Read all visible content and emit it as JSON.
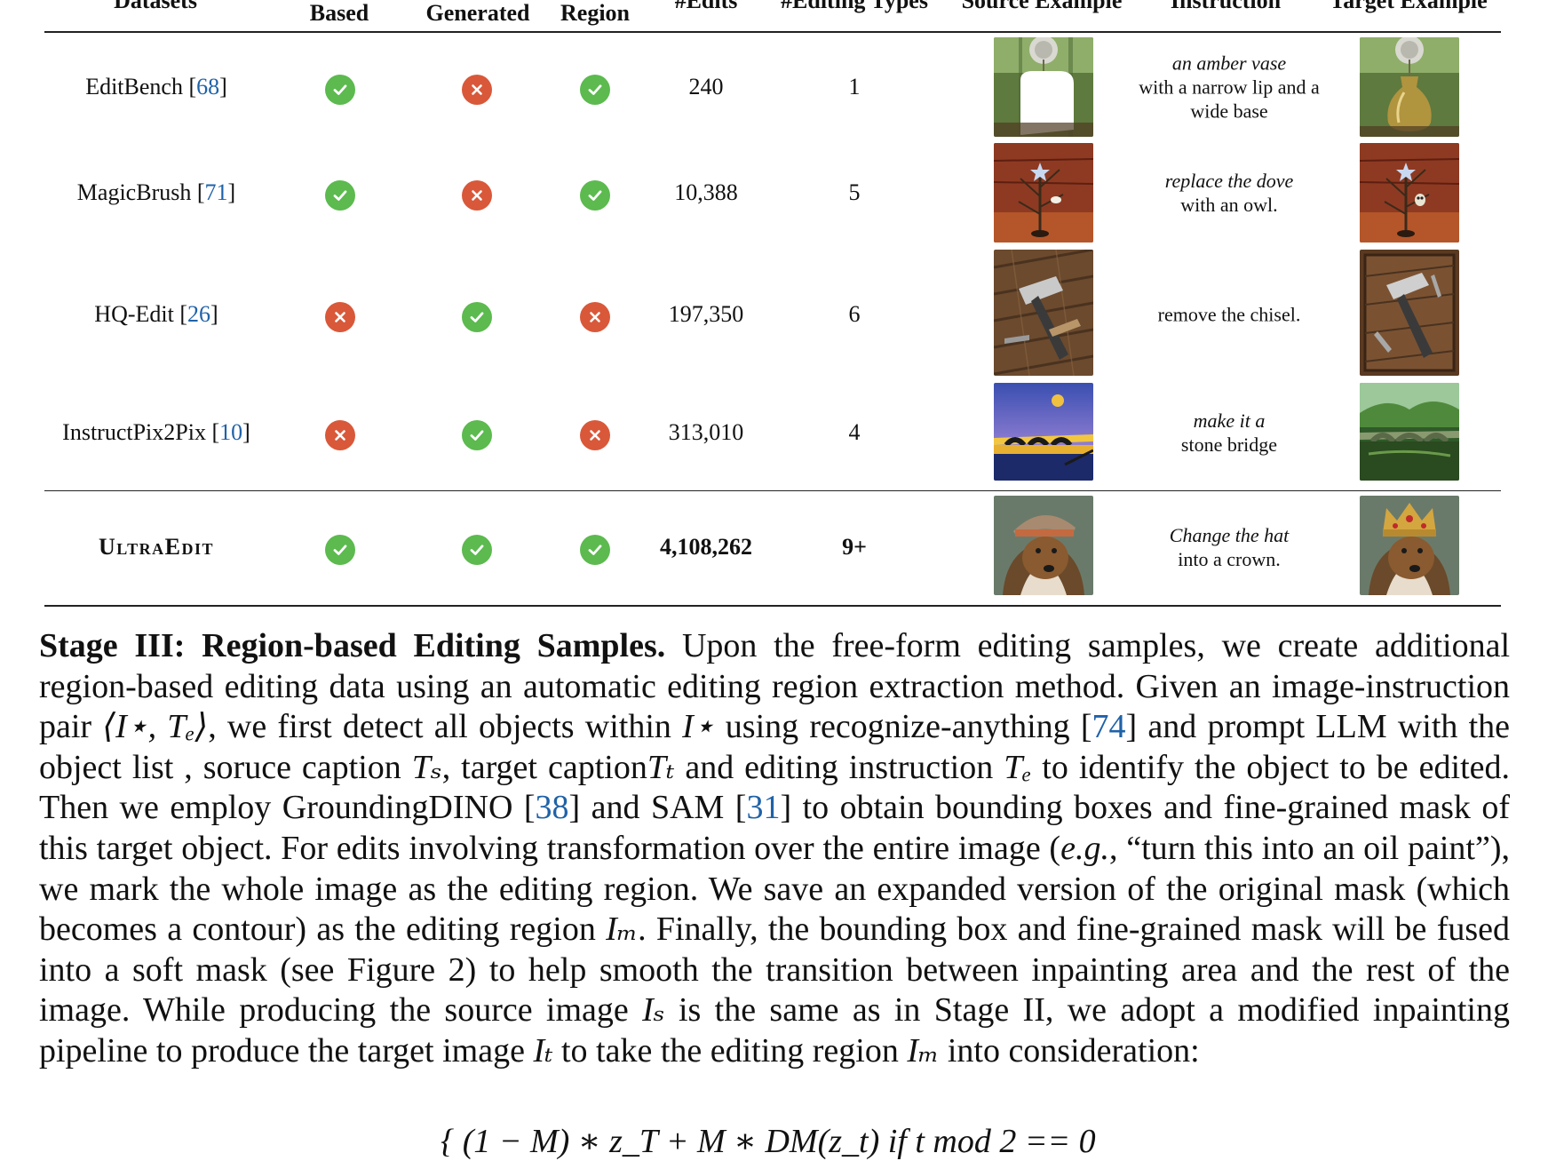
{
  "table": {
    "headers": [
      {
        "key": "datasets",
        "label": "Datasets"
      },
      {
        "key": "region_based",
        "label": "Based"
      },
      {
        "key": "auto_generated",
        "label": "Generated"
      },
      {
        "key": "editing_region",
        "label": "Region"
      },
      {
        "key": "edits",
        "label": "#Edits"
      },
      {
        "key": "types",
        "label": "#Editing Types"
      },
      {
        "key": "source",
        "label": "Source Example"
      },
      {
        "key": "instruction",
        "label": "Instruction"
      },
      {
        "key": "target",
        "label": "Target Example"
      }
    ],
    "rows": [
      {
        "name": "EditBench",
        "cite": "68",
        "c1": true,
        "c2": false,
        "c3": true,
        "edits": "240",
        "types": "1",
        "instruction_italic": "an amber vase",
        "instruction_rest": "with a narrow lip and a wide base"
      },
      {
        "name": "MagicBrush",
        "cite": "71",
        "c1": true,
        "c2": false,
        "c3": true,
        "edits": "10,388",
        "types": "5",
        "instruction_italic": "replace the dove",
        "instruction_rest": "with an owl."
      },
      {
        "name": "HQ-Edit",
        "cite": "26",
        "c1": false,
        "c2": true,
        "c3": false,
        "edits": "197,350",
        "types": "6",
        "instruction_italic": "",
        "instruction_rest": "remove the chisel."
      },
      {
        "name": "InstructPix2Pix",
        "cite": "10",
        "c1": false,
        "c2": true,
        "c3": false,
        "edits": "313,010",
        "types": "4",
        "instruction_italic": "make it a",
        "instruction_rest": "stone bridge"
      },
      {
        "name": "UltraEdit",
        "cite": "",
        "c1": true,
        "c2": true,
        "c3": true,
        "edits": "4,108,262",
        "types": "9+",
        "instruction_italic": "Change the hat",
        "instruction_rest": "into a crown."
      }
    ]
  },
  "paragraph": {
    "heading": "Stage III: Region-based Editing Samples.",
    "t1": " Upon the free-form editing samples, we create additional region-based editing data using an automatic editing region extraction method. Given an image-instruction pair ",
    "m_pair": "⟨I⋆, Tₑ⟩",
    "t2": ", we first detect all objects within ",
    "m_istar": "I⋆",
    "t3": " using recognize-anything [",
    "c74": "74",
    "t4": "] and prompt LLM with the object list , soruce caption ",
    "m_ts": "Tₛ",
    "t5": ", target caption",
    "m_tt": "Tₜ",
    "t6": " and editing instruction ",
    "m_te": "Tₑ",
    "t7": " to identify the object to be edited. Then we employ GroundingDINO [",
    "c38": "38",
    "t8": "] and SAM [",
    "c31": "31",
    "t9": "] to obtain bounding boxes and fine-grained mask of this target object. For edits involving transformation over the entire image (",
    "eg": "e.g.",
    "t10": ", “turn this into an oil paint”), we mark the whole image as the editing region. We save an expanded version of the original mask (which becomes a contour) as the editing region ",
    "m_im": "Iₘ",
    "t11": ". Finally, the bounding box and fine-grained mask will be fused into a soft mask (see Figure 2) to help smooth the transition between inpainting area and the rest of the image. While producing the source image ",
    "m_is": "Iₛ",
    "t12": " is the same as in Stage II, we adopt a modified inpainting pipeline to produce the target image ",
    "m_it": "Iₜ",
    "t13": " to take the editing region ",
    "m_im2": "Iₘ",
    "t14": " into consideration:",
    "equation": "{ (1 − M) ∗ z_T + M ∗ DM(z_t)    if t mod 2 == 0"
  },
  "colors": {
    "check": "#5cba4f",
    "cross": "#d9583a",
    "citation": "#1f62a8"
  }
}
